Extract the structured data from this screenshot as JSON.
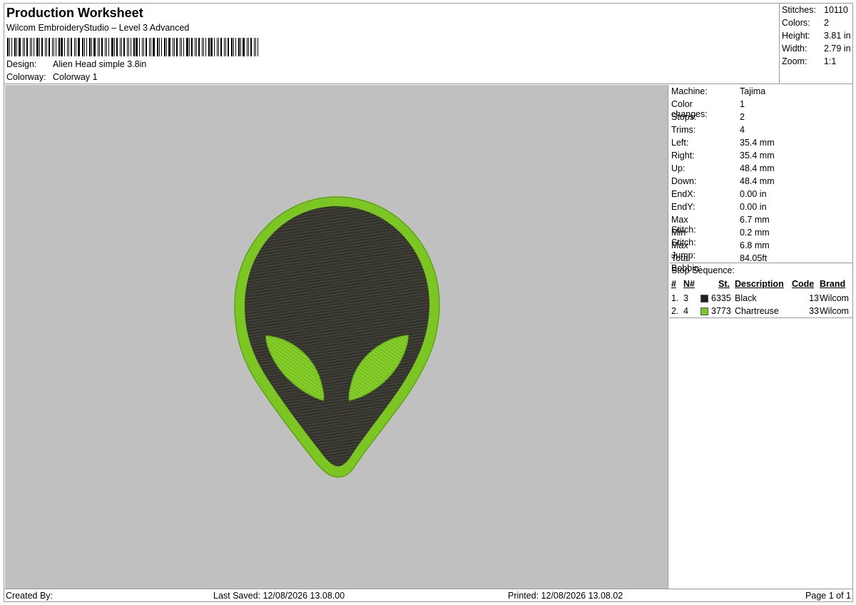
{
  "header": {
    "title": "Production Worksheet",
    "subtitle": "Wilcom EmbroideryStudio – Level 3 Advanced",
    "design_label": "Design:",
    "design_value": "Alien Head simple 3.8in",
    "colorway_label": "Colorway:",
    "colorway_value": "Colorway 1"
  },
  "stats": {
    "stitches_label": "Stitches:",
    "stitches_value": "10110",
    "colors_label": "Colors:",
    "colors_value": "2",
    "height_label": "Height:",
    "height_value": "3.81 in",
    "width_label": "Width:",
    "width_value": "2.79 in",
    "zoom_label": "Zoom:",
    "zoom_value": "1:1"
  },
  "machine": {
    "rows": [
      {
        "label": "Machine:",
        "value": "Tajima"
      },
      {
        "label": "Color changes:",
        "value": "1"
      },
      {
        "label": "Stops:",
        "value": "2"
      },
      {
        "label": "Trims:",
        "value": "4"
      },
      {
        "label": "Left:",
        "value": "35.4 mm"
      },
      {
        "label": "Right:",
        "value": "35.4 mm"
      },
      {
        "label": "Up:",
        "value": "48.4 mm"
      },
      {
        "label": "Down:",
        "value": "48.4 mm"
      },
      {
        "label": "EndX:",
        "value": "0.00 in"
      },
      {
        "label": "EndY:",
        "value": "0.00 in"
      },
      {
        "label": "Max Stitch:",
        "value": "6.7 mm"
      },
      {
        "label": "Min Stitch:",
        "value": "0.2 mm"
      },
      {
        "label": "Max Jump:",
        "value": "6.8 mm"
      },
      {
        "label": "Total Bobbin:",
        "value": "84.05ft"
      }
    ]
  },
  "stop_sequence": {
    "title": "Stop Sequence:",
    "headers": {
      "num": "#",
      "needle": "N#",
      "st": "St.",
      "description": "Description",
      "code": "Code",
      "brand": "Brand"
    },
    "rows": [
      {
        "num": "1.",
        "needle": "3",
        "color": "#231f20",
        "st": "6335",
        "description": "Black",
        "code": "13",
        "brand": "Wilcom"
      },
      {
        "num": "2.",
        "needle": "4",
        "color": "#7cc623",
        "st": "3773",
        "description": "Chartreuse",
        "code": "33",
        "brand": "Wilcom"
      }
    ]
  },
  "footer": {
    "created_by": "Created By:",
    "last_saved": "Last Saved: 12/08/2026 13.08.00",
    "printed": "Printed: 12/08/2026 13.08.02",
    "page": "Page 1 of 1"
  },
  "colors": {
    "canvas_bg": "#c0c0c0",
    "alien_fill": "#3a3a33",
    "alien_outline": "#7cc623"
  }
}
